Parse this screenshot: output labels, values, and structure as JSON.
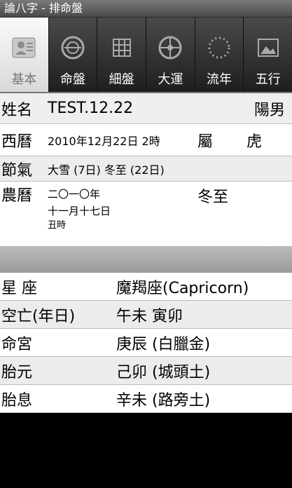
{
  "window": {
    "title": "論八字 - 排命盤"
  },
  "tabs": [
    {
      "label": "基本",
      "icon": "person-card-icon",
      "active": true
    },
    {
      "label": "命盤",
      "icon": "compass-disc-icon",
      "active": false
    },
    {
      "label": "細盤",
      "icon": "calendar-grid-icon",
      "active": false
    },
    {
      "label": "大運",
      "icon": "wheel-icon",
      "active": false
    },
    {
      "label": "流年",
      "icon": "dotted-circle-icon",
      "active": false
    },
    {
      "label": "五行",
      "icon": "picture-frame-icon",
      "active": false
    }
  ],
  "profile": {
    "name_label": "姓名",
    "name_value": "TEST.12.22",
    "gender": "陽男",
    "gregorian_label": "西曆",
    "gregorian_value": "2010年12月22日 2時",
    "zodiac_label": "屬",
    "zodiac_value": "虎",
    "solar_term_label": "節氣",
    "solar_term_value": "大雪 (7日) 冬至 (22日)",
    "lunar_label": "農曆",
    "lunar_year": "二〇一〇年",
    "lunar_date": "十一月十七日",
    "lunar_hour": "丑時",
    "lunar_term": "冬至"
  },
  "details": [
    {
      "label": "星 座",
      "value": "魔羯座(Capricorn)"
    },
    {
      "label": "空亡(年日)",
      "value": "午未 寅卯"
    },
    {
      "label": "命宮",
      "value": "庚辰 (白臘金)"
    },
    {
      "label": "胎元",
      "value": "己卯 (城頭土)"
    },
    {
      "label": "胎息",
      "value": "辛未 (路旁土)"
    }
  ]
}
